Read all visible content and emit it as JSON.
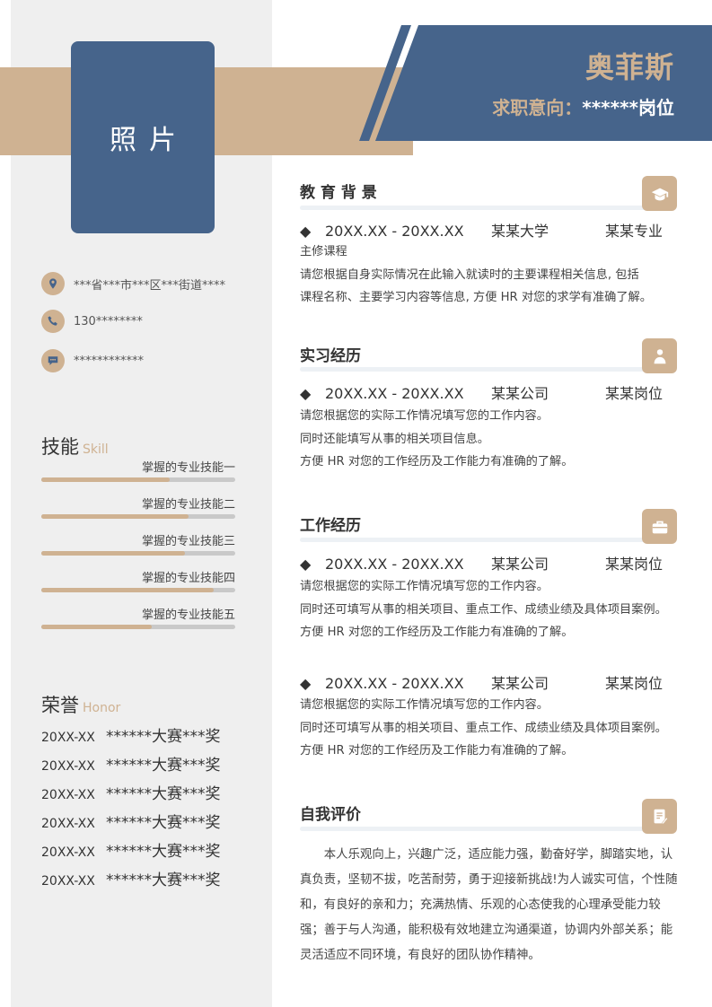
{
  "header": {
    "name": "奥菲斯",
    "intent_label": "求职意向：",
    "intent_value": "******岗位"
  },
  "photo": {
    "label": "照片"
  },
  "contact": [
    {
      "icon": "location-icon",
      "text": "***省***市***区***街道****"
    },
    {
      "icon": "phone-icon",
      "text": "130********"
    },
    {
      "icon": "message-icon",
      "text": "************"
    }
  ],
  "skills": {
    "title": "技能",
    "subtitle": "Skill",
    "items": [
      {
        "label": "掌握的专业技能一",
        "level": 0.66
      },
      {
        "label": "掌握的专业技能二",
        "level": 0.76
      },
      {
        "label": "掌握的专业技能三",
        "level": 0.74
      },
      {
        "label": "掌握的专业技能四",
        "level": 0.89
      },
      {
        "label": "掌握的专业技能五",
        "level": 0.57
      }
    ]
  },
  "honors": {
    "title": "荣誉",
    "subtitle": "Honor",
    "items": [
      {
        "date": "20XX-XX",
        "text": "******大赛***奖"
      },
      {
        "date": "20XX-XX",
        "text": "******大赛***奖"
      },
      {
        "date": "20XX-XX",
        "text": "******大赛***奖"
      },
      {
        "date": "20XX-XX",
        "text": "******大赛***奖"
      },
      {
        "date": "20XX-XX",
        "text": "******大赛***奖"
      },
      {
        "date": "20XX-XX",
        "text": "******大赛***奖"
      }
    ]
  },
  "education": {
    "title": "教 育 背 景",
    "icon": "graduation-cap-icon",
    "entry": {
      "bullet": "◆",
      "date": "20XX.XX - 20XX.XX",
      "org": "某某大学",
      "role": "某某专业"
    },
    "lines": [
      "主修课程",
      "请您根据自身实际情况在此输入就读时的主要课程相关信息, 包括",
      "课程名称、主要学习内容等信息, 方便 HR 对您的求学有准确了解。"
    ]
  },
  "internship": {
    "title": "实习经历",
    "icon": "person-icon",
    "entry": {
      "bullet": "◆",
      "date": "20XX.XX - 20XX.XX",
      "org": "某某公司",
      "role": "某某岗位"
    },
    "lines": [
      "请您根据您的实际工作情况填写您的工作内容。",
      "同时还能填写从事的相关项目信息。",
      "方便 HR 对您的工作经历及工作能力有准确的了解。"
    ]
  },
  "work": {
    "title": "工作经历",
    "icon": "briefcase-icon",
    "entries": [
      {
        "bullet": "◆",
        "date": "20XX.XX - 20XX.XX",
        "org": "某某公司",
        "role": "某某岗位",
        "lines": [
          "请您根据您的实际工作情况填写您的工作内容。",
          "同时还可填写从事的相关项目、重点工作、成绩业绩及具体项目案例。",
          "方便 HR 对您的工作经历及工作能力有准确的了解。"
        ]
      },
      {
        "bullet": "◆",
        "date": "20XX.XX - 20XX.XX",
        "org": "某某公司",
        "role": "某某岗位",
        "lines": [
          "请您根据您的实际工作情况填写您的工作内容。",
          "同时还可填写从事的相关项目、重点工作、成绩业绩及具体项目案例。",
          "方便 HR 对您的工作经历及工作能力有准确的了解。"
        ]
      }
    ]
  },
  "self_eval": {
    "title": "自我评价",
    "icon": "notepad-icon",
    "text": "本人乐观向上，兴趣广泛，适应能力强，勤奋好学，脚踏实地，认真负责，坚韧不拔，吃苦耐劳，勇于迎接新挑战!为人诚实可信，个性随和，有良好的亲和力；充满热情、乐观的心态使我的心理承受能力较强；善于与人沟通，能积极有效地建立沟通渠道，协调内外部关系；能灵活适应不同环境，有良好的团队协作精神。"
  },
  "colors": {
    "navy": "#46648b",
    "tan": "#cfb292",
    "sidebar": "#efefef"
  }
}
